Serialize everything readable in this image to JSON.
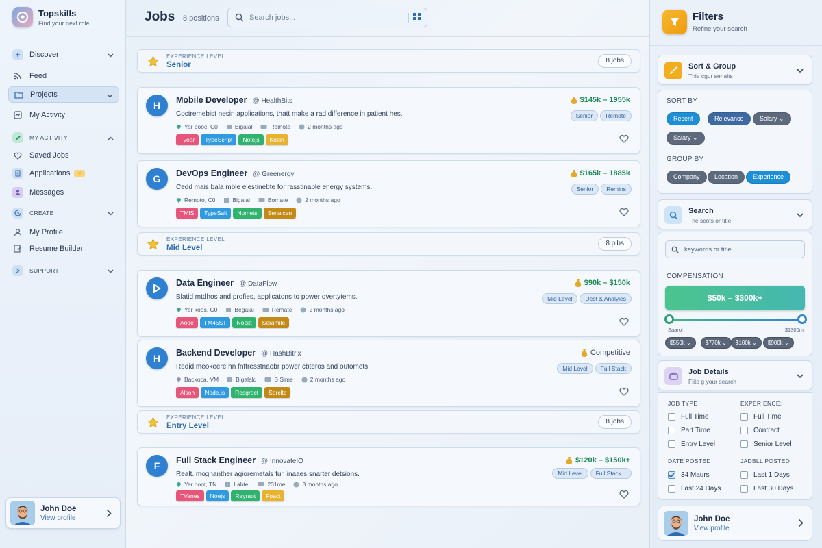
{
  "brand": {
    "name": "Topskills",
    "tagline": "Find your next role"
  },
  "sidebar": {
    "items": [
      {
        "label": "Discover",
        "type": "group"
      },
      {
        "label": "Feed"
      },
      {
        "label": "Projects"
      },
      {
        "label": "My Activity"
      },
      {
        "label": "MY ACTIVITY",
        "type": "group"
      },
      {
        "label": "Saved Jobs"
      },
      {
        "label": "Applications"
      },
      {
        "label": "Messages"
      },
      {
        "label": "CREATE",
        "type": "group"
      },
      {
        "label": "My Profile"
      },
      {
        "label": "Resume Builder"
      },
      {
        "label": "SUPPORT",
        "type": "group"
      }
    ]
  },
  "user": {
    "name": "John Doe",
    "link": "View profile"
  },
  "header": {
    "title": "Jobs",
    "count": "8 positions",
    "search_placeholder": "Search jobs..."
  },
  "levels": [
    {
      "caption": "EXPERIENCE LEVEL",
      "name": "Senior",
      "count": "8 jobs"
    },
    {
      "caption": "EXPERIENCE LEVEL",
      "name": "Mid Level",
      "count": "8 pibs"
    },
    {
      "caption": "EXPERIENCE LEVEL",
      "name": "Entry Level",
      "count": "8 jobs"
    }
  ],
  "jobs": [
    {
      "initial": "H",
      "title": "Mobile Developer",
      "company": "HealthBits",
      "desc": "Coctremebist nesin applications, thatt make a rad difference in patient hes.",
      "location": "Yer booc, C0",
      "size": "Bigalal",
      "mode": "Remote",
      "posted": "2 months ago",
      "tags": [
        "Tyoar",
        "TypeScript",
        "Notejs",
        "Kotlin"
      ],
      "salary": "$145k – 1955k",
      "badges": [
        "Senior",
        "Remote"
      ]
    },
    {
      "initial": "G",
      "title": "DevOps Engineer",
      "company": "Greenergy",
      "desc": "Cedd mais bala mble elestinebte for rasstinable energy systems.",
      "location": "Remoto, C0",
      "size": "Bigalal",
      "mode": "Bomate",
      "posted": "2 months ago",
      "tags": [
        "TMIS",
        "TypeSalt",
        "Nomets",
        "Senalcen"
      ],
      "salary": "$165k – 1885k",
      "badges": [
        "Senior",
        "Remins"
      ]
    },
    {
      "initial": "D",
      "title": "Data Engineer",
      "company": "DataFlow",
      "desc": "Blatid mtdhos and profies, applicatons to power overtytems.",
      "location": "Yer koos, C0",
      "size": "Begalal",
      "mode": "Remate",
      "posted": "2 months ago",
      "tags": [
        "Aode",
        "TM45ST",
        "Nooitt",
        "Seramile"
      ],
      "salary": "$90k – $150k",
      "badges": [
        "Mid Level",
        "Dest & Analyies"
      ]
    },
    {
      "initial": "H",
      "title": "Backend Developer",
      "company": "HashBitrix",
      "desc": "Redid meokeere hn fnftresstnaobr power cbteros and outomets.",
      "location": "Backoca, VM",
      "size": "Bigalald",
      "mode": "B Sime",
      "posted": "2 months ago",
      "tags": [
        "Alson",
        "Node.js",
        "Resgroct",
        "Sorcltc"
      ],
      "salary": "Competitive",
      "badges": [
        "Mid Level",
        "Full Stack"
      ]
    },
    {
      "initial": "F",
      "title": "Full Stack Engineer",
      "company": "InnovateIQ",
      "desc": "Realt. mognanther agioremetals fur linaaes snarter detsions.",
      "location": "Yer boot, TN",
      "size": "Labtel",
      "mode": "231me",
      "posted": "3 months ago",
      "tags": [
        "TVanes",
        "Noejs",
        "Reyraot",
        "Foact"
      ],
      "salary": "$120k – $150k+",
      "badges": [
        "Mid Level",
        "Full Stack..."
      ]
    }
  ],
  "filters": {
    "title": "Filters",
    "subtitle": "Refine your search",
    "sort_group": {
      "title": "Sort & Group",
      "subtitle": "Thie cgur senalts",
      "sort_label": "SORT BY",
      "sort_options": [
        "Recent",
        "Relevance",
        "Salary ⌄",
        "Salary ⌄"
      ],
      "group_label": "GROUP BY",
      "group_options": [
        "Company",
        "Location",
        "Experience"
      ]
    },
    "search": {
      "title": "Search",
      "subtitle": "The scots or title",
      "placeholder": "keywords or title",
      "comp_label": "COMPENSATION",
      "comp_range": "$50k – $300k+",
      "slider_min_label": "Saarol",
      "slider_max_label": "$1300m",
      "slider_min": 0.0,
      "slider_max": 1.0,
      "chips": [
        "$550k ⌄",
        "$770k ⌄",
        "$100k ⌄",
        "$900k ⌄"
      ]
    },
    "job_details": {
      "title": "Job Details",
      "subtitle": "Fiite g your search",
      "job_type_label": "JOB TYPE",
      "job_types": [
        "Full Time",
        "Part Time",
        "Entry Level"
      ],
      "experience_label": "EXPERIENCE:",
      "experiences": [
        "Full Time",
        "Contract",
        "Senior Level"
      ],
      "date_label": "DATE POSTED",
      "dates": [
        {
          "label": "34 Maurs",
          "checked": true
        },
        {
          "label": "Last 24 Days",
          "checked": false
        }
      ],
      "date2_label": "JADBLL POSTED",
      "dates2": [
        {
          "label": "Last 1 Days",
          "checked": false
        },
        {
          "label": "Last 30 Days",
          "checked": false
        }
      ]
    }
  },
  "colors": {
    "accent": "#2f80d0",
    "tag_red": "#e8557a",
    "tag_blue": "#2f9ae0",
    "tag_green": "#2fb36f",
    "tag_gold": "#d6a020",
    "salary_green": "#1e8a56"
  }
}
